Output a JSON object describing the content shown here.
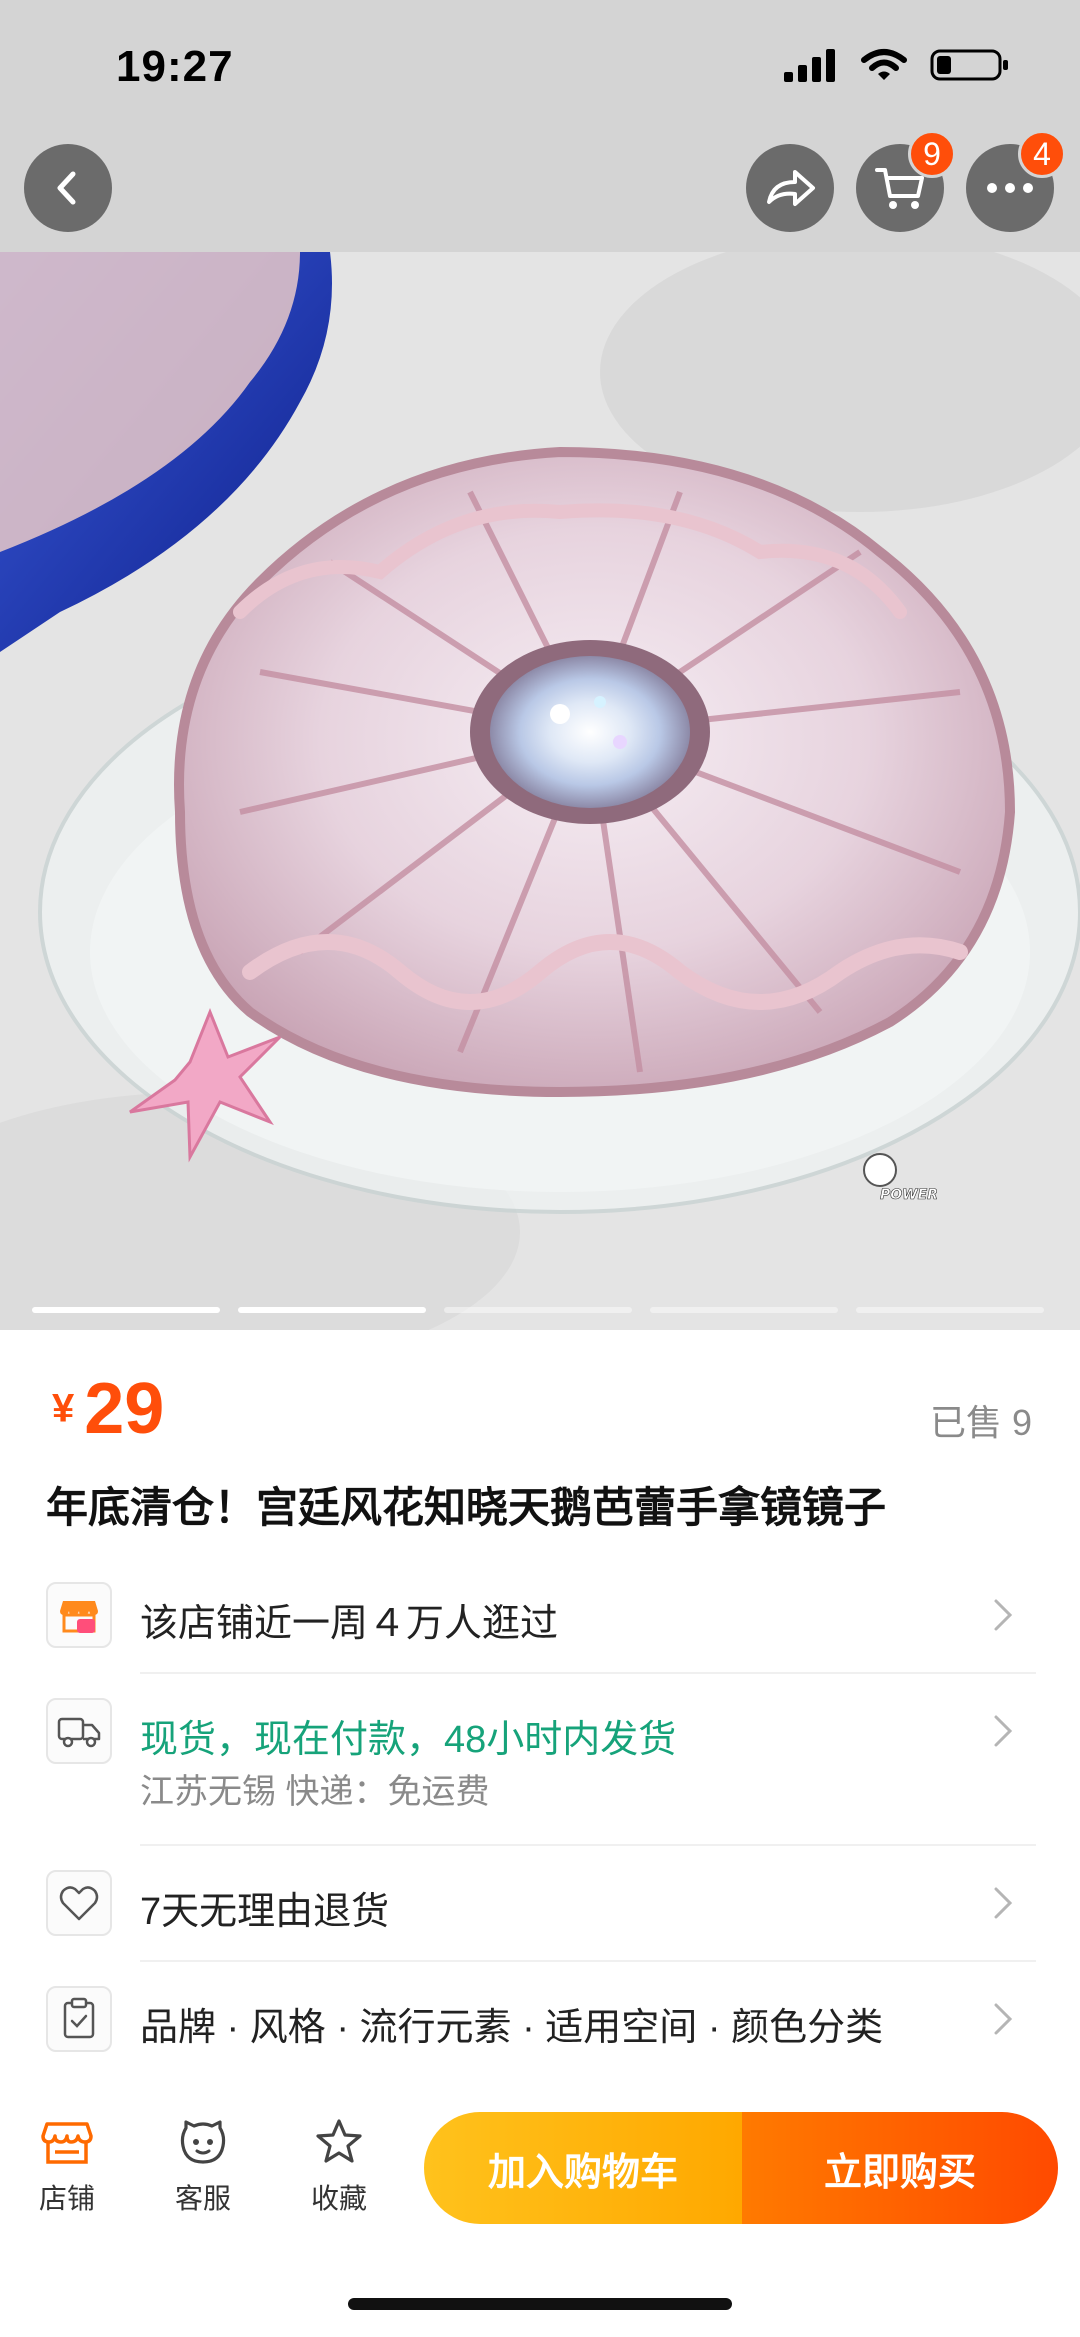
{
  "status_bar": {
    "time": "19:27"
  },
  "header": {
    "back_icon": "chevron-left-icon",
    "share_icon": "share-icon",
    "cart_icon": "cart-icon",
    "cart_badge": "9",
    "more_icon": "more-icon",
    "more_badge": "4"
  },
  "gallery": {
    "pages": 5,
    "active_index": 1,
    "watermark": "POWER"
  },
  "product": {
    "currency": "¥",
    "price": "29",
    "sold": "已售 9",
    "title": "年底清仓！宫廷风花知晓天鹅芭蕾手拿镜镜子"
  },
  "info_rows": [
    {
      "icon": "store-icon",
      "text": "该店铺近一周４万人逛过"
    },
    {
      "icon": "truck-icon",
      "text": "现货，现在付款，48小时内发货",
      "sub": "江苏无锡  快递：免运费",
      "color": "#16a37a"
    },
    {
      "icon": "tag-heart-icon",
      "text": "7天无理由退货"
    },
    {
      "icon": "clipboard-icon",
      "text": "品牌 · 风格 · 流行元素 · 适用空间 · 颜色分类"
    }
  ],
  "bottom_bar": {
    "tabs": [
      {
        "label": "店铺",
        "icon": "store-icon"
      },
      {
        "label": "客服",
        "icon": "service-icon"
      },
      {
        "label": "收藏",
        "icon": "star-icon"
      }
    ],
    "add_to_cart": "加入购物车",
    "buy_now": "立即购买"
  },
  "colors": {
    "accent": "#ff4e0a",
    "green": "#16a37a",
    "cart_btn": "#ffb300",
    "buy_btn": "#ff5a00"
  }
}
